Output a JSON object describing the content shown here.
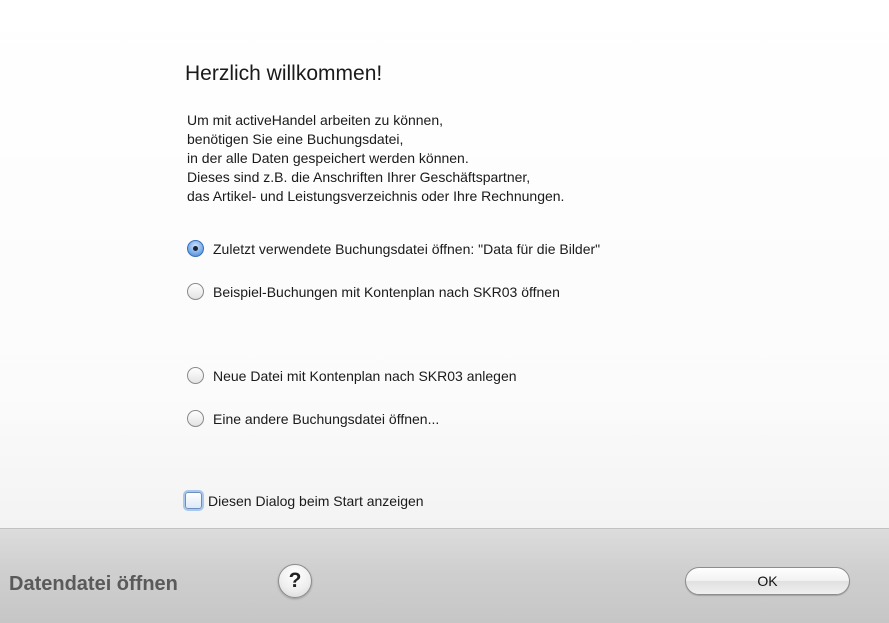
{
  "dialog": {
    "title": "Herzlich willkommen!",
    "intro_lines": [
      "Um mit activeHandel arbeiten zu können,",
      "benötigen Sie eine Buchungsdatei,",
      "in der alle Daten gespeichert werden können.",
      "Dieses sind z.B. die Anschriften Ihrer Geschäftspartner,",
      "das Artikel- und Leistungsverzeichnis oder Ihre Rechnungen."
    ],
    "options": [
      {
        "label": "Zuletzt verwendete Buchungsdatei öffnen: \"Data für die Bilder\"",
        "selected": true
      },
      {
        "label": "Beispiel-Buchungen mit Kontenplan nach SKR03 öffnen",
        "selected": false
      },
      {
        "label": "Neue Datei mit Kontenplan nach SKR03 anlegen",
        "selected": false
      },
      {
        "label": "Eine andere Buchungsdatei öffnen...",
        "selected": false
      }
    ],
    "show_on_start": {
      "label": "Diesen Dialog beim Start anzeigen",
      "checked": false
    }
  },
  "footer": {
    "title": "Datendatei öffnen",
    "help_label": "?",
    "ok_label": "OK"
  },
  "colors": {
    "accent": "#3d7fd6",
    "footer_text": "#5a5a5a"
  }
}
